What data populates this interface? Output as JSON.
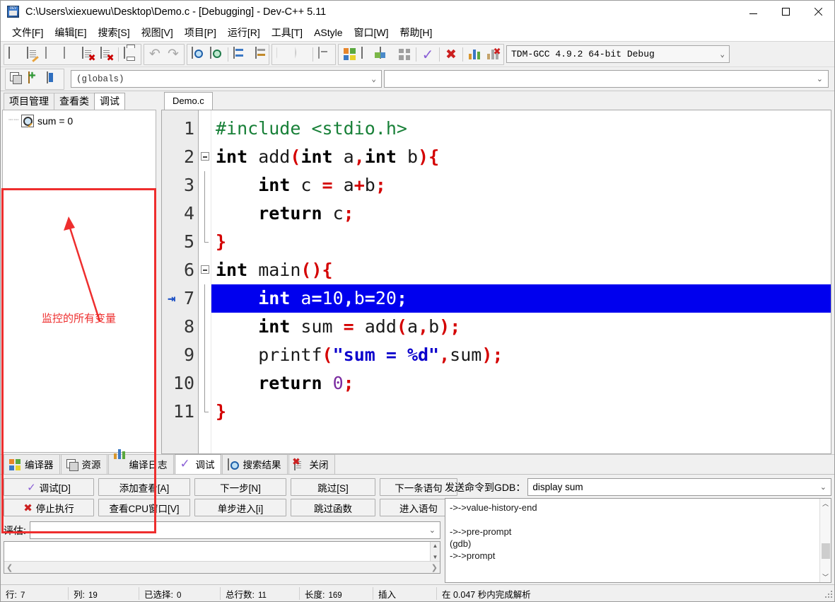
{
  "window": {
    "title": "C:\\Users\\xiexuewu\\Desktop\\Demo.c - [Debugging] - Dev-C++ 5.11",
    "icon": "devcpp-app-icon",
    "minimize": "–",
    "maximize": "□",
    "close": "✕"
  },
  "menubar": {
    "items": [
      {
        "label": "文件[F]"
      },
      {
        "label": "编辑[E]"
      },
      {
        "label": "搜索[S]"
      },
      {
        "label": "视图[V]"
      },
      {
        "label": "项目[P]"
      },
      {
        "label": "运行[R]"
      },
      {
        "label": "工具[T]"
      },
      {
        "label": "AStyle"
      },
      {
        "label": "窗口[W]"
      },
      {
        "label": "帮助[H]"
      }
    ]
  },
  "toolbar": {
    "compiler_selector": {
      "value": "TDM-GCC 4.9.2 64-bit Debug",
      "caret": "⌄"
    },
    "icons": [
      "new-file-icon",
      "open-file-icon",
      "save-icon",
      "save-all-icon",
      "close-file-icon",
      "close-all-icon",
      "print-icon",
      "undo-icon",
      "redo-icon",
      "find-icon",
      "replace-icon",
      "goto-line-icon",
      "goto-function-icon",
      "prev-tab-icon",
      "next-tab-icon",
      "toggle-panel-icon",
      "project-manager-icon",
      "window-icon",
      "class-browser-icon",
      "tile-icon",
      "compile-icon",
      "stop-icon",
      "profile-icon",
      "debug-stop-icon"
    ]
  },
  "toolbar2": {
    "icons": [
      "copy-window-icon",
      "add-folder-icon",
      "book-icon"
    ],
    "globals_combo": {
      "value": "(globals)",
      "caret": "⌄"
    },
    "member_combo": {
      "value": "",
      "caret": "⌄"
    }
  },
  "left_panel": {
    "tabs": [
      {
        "label": "项目管理",
        "active": false
      },
      {
        "label": "查看类",
        "active": false
      },
      {
        "label": "调试",
        "active": true
      }
    ],
    "watch_items": [
      {
        "prefix": "┈┈",
        "icon": "watch-variable-icon",
        "label": "sum = 0"
      }
    ],
    "annotation": {
      "text": "监控的所有变量",
      "color": "#ee2e2e"
    }
  },
  "editor": {
    "tabs": [
      {
        "label": "Demo.c",
        "active": true
      }
    ],
    "current_line": 7,
    "lines": [
      {
        "number": "1",
        "fold": "none",
        "highlight": false,
        "tokens": [
          {
            "t": "#include <stdio.h>",
            "c": "pre"
          }
        ]
      },
      {
        "number": "2",
        "fold": "open",
        "highlight": false,
        "tokens": [
          {
            "t": "int",
            "c": "kw"
          },
          {
            "t": " add",
            "c": "id"
          },
          {
            "t": "(",
            "c": "pun"
          },
          {
            "t": "int",
            "c": "kw"
          },
          {
            "t": " a",
            "c": "id"
          },
          {
            "t": ",",
            "c": "pun"
          },
          {
            "t": "int",
            "c": "kw"
          },
          {
            "t": " b",
            "c": "id"
          },
          {
            "t": ")",
            "c": "pun"
          },
          {
            "t": "{",
            "c": "pun"
          }
        ]
      },
      {
        "number": "3",
        "fold": "bar",
        "highlight": false,
        "tokens": [
          {
            "t": "    ",
            "c": "id"
          },
          {
            "t": "int",
            "c": "kw"
          },
          {
            "t": " c ",
            "c": "id"
          },
          {
            "t": "=",
            "c": "pun"
          },
          {
            "t": " a",
            "c": "id"
          },
          {
            "t": "+",
            "c": "pun"
          },
          {
            "t": "b",
            "c": "id"
          },
          {
            "t": ";",
            "c": "pun"
          }
        ]
      },
      {
        "number": "4",
        "fold": "bar",
        "highlight": false,
        "tokens": [
          {
            "t": "    ",
            "c": "id"
          },
          {
            "t": "return",
            "c": "kw"
          },
          {
            "t": " c",
            "c": "id"
          },
          {
            "t": ";",
            "c": "pun"
          }
        ]
      },
      {
        "number": "5",
        "fold": "close",
        "highlight": false,
        "tokens": [
          {
            "t": "}",
            "c": "pun"
          }
        ]
      },
      {
        "number": "6",
        "fold": "open",
        "highlight": false,
        "tokens": [
          {
            "t": "int",
            "c": "kw"
          },
          {
            "t": " main",
            "c": "id"
          },
          {
            "t": "()",
            "c": "pun"
          },
          {
            "t": "{",
            "c": "pun"
          }
        ]
      },
      {
        "number": "7",
        "fold": "bar",
        "highlight": true,
        "marker": "⇥",
        "tokens": [
          {
            "t": "    ",
            "c": "id"
          },
          {
            "t": "int",
            "c": "kw"
          },
          {
            "t": " a",
            "c": "id"
          },
          {
            "t": "=",
            "c": "pun"
          },
          {
            "t": "10",
            "c": "num"
          },
          {
            "t": ",",
            "c": "pun"
          },
          {
            "t": "b",
            "c": "id"
          },
          {
            "t": "=",
            "c": "pun"
          },
          {
            "t": "20",
            "c": "num"
          },
          {
            "t": ";",
            "c": "pun"
          }
        ]
      },
      {
        "number": "8",
        "fold": "bar",
        "highlight": false,
        "tokens": [
          {
            "t": "    ",
            "c": "id"
          },
          {
            "t": "int",
            "c": "kw"
          },
          {
            "t": " sum ",
            "c": "id"
          },
          {
            "t": "=",
            "c": "pun"
          },
          {
            "t": " add",
            "c": "id"
          },
          {
            "t": "(",
            "c": "pun"
          },
          {
            "t": "a",
            "c": "id"
          },
          {
            "t": ",",
            "c": "pun"
          },
          {
            "t": "b",
            "c": "id"
          },
          {
            "t": ")",
            "c": "pun"
          },
          {
            "t": ";",
            "c": "pun"
          }
        ]
      },
      {
        "number": "9",
        "fold": "bar",
        "highlight": false,
        "tokens": [
          {
            "t": "    ",
            "c": "id"
          },
          {
            "t": "printf",
            "c": "id"
          },
          {
            "t": "(",
            "c": "pun"
          },
          {
            "t": "\"sum = %d\"",
            "c": "str"
          },
          {
            "t": ",",
            "c": "pun"
          },
          {
            "t": "sum",
            "c": "id"
          },
          {
            "t": ")",
            "c": "pun"
          },
          {
            "t": ";",
            "c": "pun"
          }
        ]
      },
      {
        "number": "10",
        "fold": "bar",
        "highlight": false,
        "tokens": [
          {
            "t": "    ",
            "c": "id"
          },
          {
            "t": "return",
            "c": "kw"
          },
          {
            "t": " ",
            "c": "id"
          },
          {
            "t": "0",
            "c": "num"
          },
          {
            "t": ";",
            "c": "pun"
          }
        ]
      },
      {
        "number": "11",
        "fold": "close",
        "highlight": false,
        "tokens": [
          {
            "t": "}",
            "c": "pun"
          }
        ]
      }
    ]
  },
  "bottom_tabs": [
    {
      "label": "编译器",
      "icon": "compiler-icon",
      "active": false
    },
    {
      "label": "资源",
      "icon": "resource-icon",
      "active": false
    },
    {
      "label": "编译日志",
      "icon": "log-icon",
      "active": false
    },
    {
      "label": "调试",
      "icon": "debug-check-icon",
      "active": true
    },
    {
      "label": "搜索结果",
      "icon": "search-result-icon",
      "active": false
    },
    {
      "label": "关闭",
      "icon": "close-panel-icon",
      "active": false
    }
  ],
  "debug_panel": {
    "buttons_row1": [
      {
        "label": "调试[D]",
        "icon": "check-icon"
      },
      {
        "label": "添加查看[A]",
        "icon": ""
      },
      {
        "label": "下一步[N]",
        "icon": ""
      },
      {
        "label": "跳过[S]",
        "icon": ""
      },
      {
        "label": "下一条语句",
        "icon": ""
      }
    ],
    "buttons_row2": [
      {
        "label": "停止执行",
        "icon": "stop-x-icon"
      },
      {
        "label": "查看CPU窗口[V]",
        "icon": ""
      },
      {
        "label": "单步进入[i]",
        "icon": ""
      },
      {
        "label": "跳过函数",
        "icon": ""
      },
      {
        "label": "进入语句",
        "icon": ""
      }
    ],
    "evaluate": {
      "label": "评估:",
      "value": "",
      "placeholder": "",
      "caret": "⌄",
      "result": ""
    }
  },
  "gdb_panel": {
    "label": "发送命令到GDB：",
    "command": {
      "value": "display sum",
      "caret": "⌄"
    },
    "output_lines": [
      "->->value-history-end",
      "",
      "->->pre-prompt",
      "(gdb)",
      "->->prompt"
    ],
    "scroll_up": "︿",
    "scroll_down": "﹀"
  },
  "statusbar": {
    "cells": [
      {
        "key": "行:",
        "value": "7"
      },
      {
        "key": "列:",
        "value": "19"
      },
      {
        "key": "已选择:",
        "value": "0"
      },
      {
        "key": "总行数:",
        "value": "11"
      },
      {
        "key": "长度:",
        "value": "169"
      },
      {
        "key": "插入",
        "value": ""
      },
      {
        "key": "在 0.047 秒内完成解析",
        "value": ""
      }
    ]
  },
  "colors": {
    "highlight_line": "#0000ee",
    "annotation": "#ee2e2e",
    "preprocessor": "#188038",
    "punctuation": "#d40000",
    "string": "#0b00cc",
    "number": "#7a2aa0"
  }
}
